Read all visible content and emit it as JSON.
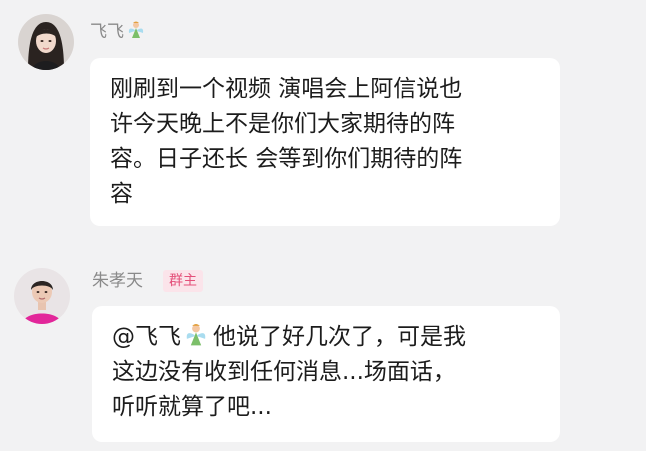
{
  "messages": [
    {
      "sender": "飞飞",
      "sender_emoji": "fairy-emoji-icon",
      "avatar": "female-user-avatar",
      "lines": [
        "刚刷到一个视频 演唱会上阿信说也",
        "许今天晚上不是你们大家期待的阵",
        "容。日子还长 会等到你们期待的阵",
        "容"
      ]
    },
    {
      "sender": "朱孝天",
      "badge": "群主",
      "avatar": "male-user-avatar",
      "mention": "@飞飞",
      "mention_emoji": "fairy-emoji-icon",
      "lines": [
        "他说了好几次了，可是我",
        "这边没有收到任何消息...场面话，",
        "听听就算了吧..."
      ]
    }
  ],
  "colors": {
    "background": "#f2f2f3",
    "bubble": "#ffffff",
    "badge_bg": "#fbe4ea",
    "badge_text": "#e4507a",
    "name_text": "#8a8a8a"
  }
}
